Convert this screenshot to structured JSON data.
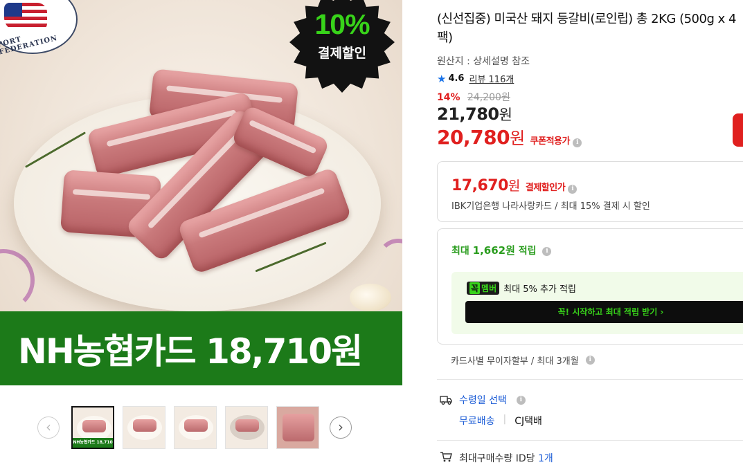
{
  "hero": {
    "federation_text": "PORT FEDERATION",
    "burst_percent": "10%",
    "burst_label": "결제할인",
    "banner_text": "NH농협카드 18,710원"
  },
  "thumbnails": {
    "prev_icon": "‹",
    "next_icon": "›",
    "items": [
      {
        "caption": "NH농협카드 18,710원"
      },
      {
        "caption": ""
      },
      {
        "caption": ""
      },
      {
        "caption": ""
      },
      {
        "caption": ""
      }
    ]
  },
  "product": {
    "title": "(신선집중) 미국산 돼지 등갈비(로인립) 총 2KG (500g x 4팩)",
    "origin": "원산지 : 상세설명 참조",
    "rating": "4.6",
    "review_label": "리뷰 116개",
    "discount_percent": "14%",
    "original_price": "24,200원",
    "price": "21,780",
    "price_unit": "원",
    "coupon_price": "20,780",
    "coupon_unit": "원",
    "coupon_tag": "쿠폰적용가"
  },
  "card_discount": {
    "amount": "17,670",
    "unit": "원",
    "tag": "결제할인가",
    "description": "IBK기업은행 나라사랑카드 / 최대 15% 결제 시 할인"
  },
  "points": {
    "prefix": "최대 ",
    "amount": "1,662원",
    "suffix": " 적립",
    "member_badge_a": "꼭",
    "member_badge_b": "멤버",
    "member_text": "최대 5% 추가 적립",
    "cta_label": "꼭! 시작하고 최대 적립 받기  ›"
  },
  "installment": "카드사별 무이자할부 / 최대 3개월",
  "delivery": {
    "select_label": "수령일 선택",
    "shipping": "무료배송",
    "carrier": "CJ택배"
  },
  "limit": {
    "label": "최대구매수량 ID당 ",
    "count": "1개"
  },
  "colors": {
    "accent_red": "#e0201f",
    "nh_green": "#1c7a19",
    "point_green": "#2a9d1e",
    "link_blue": "#1a5bd6",
    "burst_green": "#38d31a"
  },
  "icons": {
    "star": "star-icon",
    "info": "info-icon",
    "truck": "truck-icon",
    "cart": "cart-icon"
  }
}
